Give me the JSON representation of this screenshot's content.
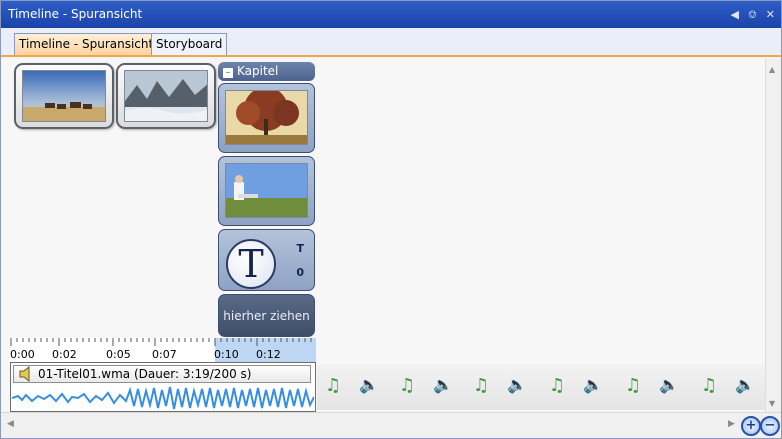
{
  "window": {
    "title": "Timeline - Spuransicht"
  },
  "tabs": [
    {
      "label": "Timeline - Spuransicht",
      "active": true
    },
    {
      "label": "Storyboard",
      "active": false
    }
  ],
  "chapter": {
    "header": "Kapitel"
  },
  "title_slot": {
    "glyph": "T",
    "line1": "T",
    "line2": "0"
  },
  "drop_zone": {
    "label": "hierher ziehen"
  },
  "ruler": {
    "ticks": [
      "0:00",
      "0:02",
      "0:05",
      "0:07",
      "0:10",
      "0:12"
    ]
  },
  "audio": {
    "label": "01-Titel01.wma (Dauer: 3:19/200 s)"
  },
  "icons": {
    "pin": "pin-icon",
    "close": "close-icon",
    "speaker": "speaker-icon",
    "note": "music-note-icon",
    "zoom_in": "zoom-in-icon",
    "zoom_out": "zoom-out-icon"
  },
  "colors": {
    "titlebar": "#1f4bb0",
    "active_tab": "#fcd3a0",
    "selection": "#bcd6f4",
    "waveform": "#3a8ee0"
  }
}
